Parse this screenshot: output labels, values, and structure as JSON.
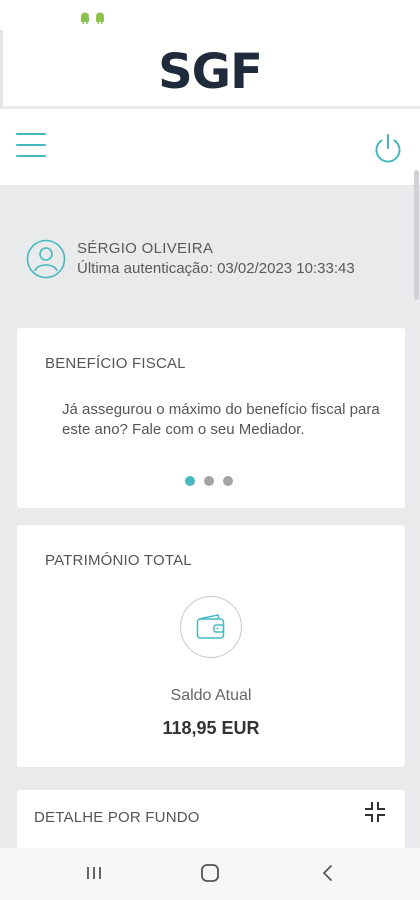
{
  "brand": {
    "logo_text": "SGF",
    "accent_color": "#47b8c0",
    "logo_color": "#1f2b3a"
  },
  "status_bar": {
    "icons": [
      "android-icon",
      "android-icon"
    ]
  },
  "toolbar": {
    "menu_icon": "hamburger-menu-icon",
    "logout_icon": "power-icon"
  },
  "user": {
    "name": "SÉRGIO OLIVEIRA",
    "last_auth": "Última autenticação: 03/02/2023 10:33:43",
    "avatar_icon": "user-avatar-icon"
  },
  "benefit_card": {
    "title": "BENEFÍCIO FISCAL",
    "text": "Já assegurou o máximo do benefício fiscal para este ano? Fale com o seu Mediador.",
    "carousel": {
      "count": 3,
      "active_index": 0
    }
  },
  "patrimonio_card": {
    "title": "PATRIMÓNIO TOTAL",
    "icon": "wallet-icon",
    "balance_label": "Saldo Atual",
    "balance_value": "118,95 EUR"
  },
  "detail_card": {
    "title": "DETALHE POR FUNDO",
    "action_icon": "collapse-icon"
  },
  "system_nav": {
    "buttons": [
      "recents-icon",
      "home-icon",
      "back-icon"
    ]
  }
}
